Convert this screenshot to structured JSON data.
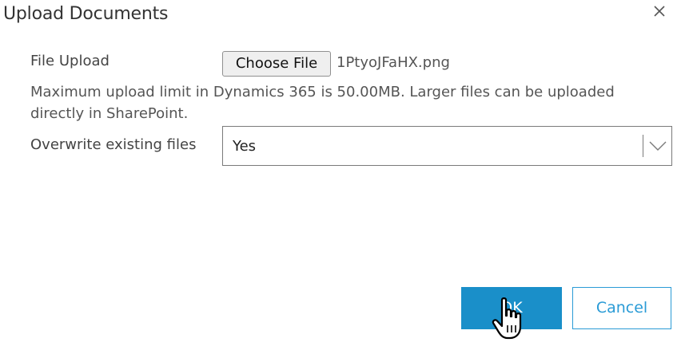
{
  "dialog": {
    "title": "Upload Documents",
    "close_icon": "close-icon"
  },
  "file_upload": {
    "label": "File Upload",
    "button_label": "Choose File",
    "selected_file": "1PtyoJFaHX.png",
    "help_text": "Maximum upload limit in Dynamics 365 is 50.00MB. Larger files can be uploaded directly in SharePoint."
  },
  "overwrite": {
    "label": "Overwrite existing files",
    "selected_value": "Yes",
    "dropdown_icon": "chevron-down-icon"
  },
  "footer": {
    "ok_label": "OK",
    "cancel_label": "Cancel"
  },
  "colors": {
    "primary": "#1a8fc9",
    "cancel_border": "#2a9bd6",
    "text": "#444444"
  },
  "cursor": {
    "icon": "hand-cursor-icon"
  }
}
